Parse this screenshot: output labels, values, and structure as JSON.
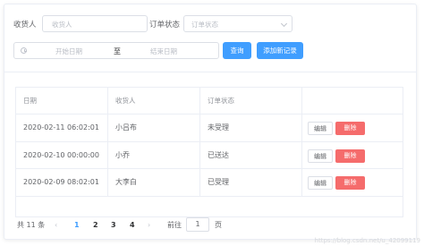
{
  "filters": {
    "receiver_label": "收货人",
    "receiver_placeholder": "收货人",
    "status_label": "订单状态",
    "status_placeholder": "订单状态",
    "start_date_placeholder": "开始日期",
    "range_separator": "至",
    "end_date_placeholder": "结束日期",
    "query_button": "查询",
    "add_button": "添加新记录"
  },
  "table": {
    "headers": [
      "日期",
      "收货人",
      "订单状态",
      ""
    ],
    "rows": [
      {
        "date": "2020-02-11 06:02:01",
        "receiver": "小吕布",
        "status": "未受理"
      },
      {
        "date": "2020-02-10 00:00:00",
        "receiver": "小乔",
        "status": "已送达"
      },
      {
        "date": "2020-02-09 08:02:01",
        "receiver": "大李白",
        "status": "已受理"
      }
    ],
    "edit_label": "编辑",
    "delete_label": "删除"
  },
  "pagination": {
    "total_text": "共 11 条",
    "prev": "‹",
    "pages": [
      "1",
      "2",
      "3",
      "4"
    ],
    "current_page": "1",
    "next": "›",
    "goto_label": "前往",
    "goto_value": "1",
    "page_unit": "页"
  },
  "watermark": "https://blog.csdn.net/u_42099119",
  "colors": {
    "primary": "#409eff",
    "danger": "#f56c6c",
    "border": "#ebeef5"
  }
}
